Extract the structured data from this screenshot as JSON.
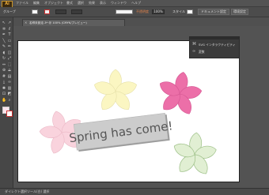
{
  "app": {
    "logo_text": "Ai"
  },
  "menus": [
    "ファイル",
    "編集",
    "オブジェクト",
    "書式",
    "選択",
    "効果",
    "表示",
    "ウィンドウ",
    "ヘルプ"
  ],
  "control_bar": {
    "selection_label": "グループ",
    "opacity_label": "不透明度",
    "opacity_value": "100%",
    "style_label": "スタイル",
    "document_setup_button": "ドキュメント設定",
    "preferences_button": "環境設定"
  },
  "document_tab": {
    "close_glyph": "×",
    "title": "名称未設定-3* @ 100% (CMYK/プレビュー)"
  },
  "artwork": {
    "banner_text": "Spring has come!",
    "colors": {
      "flower_yellow": "#fbf6c2",
      "flower_magenta": "#ec6fa8",
      "flower_pink": "#f9d3dd",
      "flower_green": "#e1efd3",
      "banner": "#cccccc"
    }
  },
  "panel": {
    "items": [
      {
        "icon": "svg-interactivity-icon",
        "label": "SVG インタラクティビティ"
      },
      {
        "icon": "links-icon",
        "label": "変数"
      }
    ]
  },
  "status_bar": {
    "text": "ダイレクト選択ツール(白) 選択"
  },
  "fill_stroke": {
    "fill": "#fbe4ec",
    "stroke": "#cc3333"
  }
}
